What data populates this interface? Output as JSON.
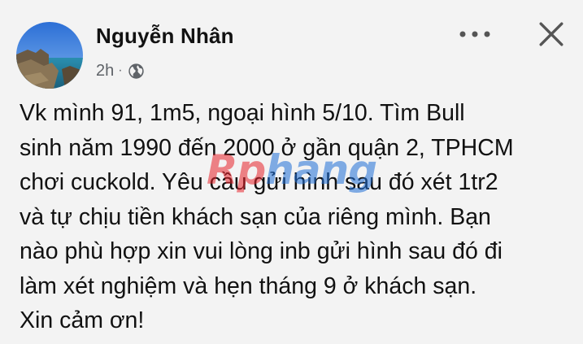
{
  "post": {
    "author": "Nguyễn Nhân",
    "time": "2h",
    "separator": "·",
    "privacy_icon": "globe-icon",
    "more_icon": "more-horizontal-icon",
    "close_icon": "close-icon",
    "body_lines": [
      "Vk mình 91, 1m5, ngoại hình 5/10. Tìm Bull",
      "sinh năm 1990 đến 2000 ở gần quận 2, TPHCM",
      "chơi cuckold. Yêu cầu gửi hình sau đó xét 1tr2",
      "và tự chịu tiền khách sạn của riêng mình. Bạn",
      "nào phù hợp xin vui lòng inb gửi hình sau đó đi",
      "làm xét nghiệm và hẹn tháng 9 ở khách sạn.",
      "Xin cảm ơn!"
    ]
  },
  "watermark": {
    "part1": "Rp",
    "part2": "hang"
  },
  "colors": {
    "background": "#f3f3f3",
    "text": "#111111",
    "meta": "#5f6368",
    "watermark_red": "#e8232b",
    "watermark_blue": "#1f6fd6"
  }
}
